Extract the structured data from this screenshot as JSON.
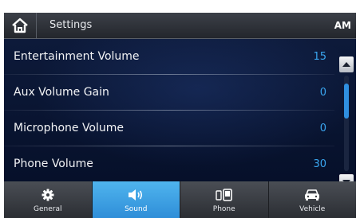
{
  "header": {
    "title": "Settings",
    "source": "AM"
  },
  "settings": [
    {
      "label": "Entertainment Volume",
      "value": "15"
    },
    {
      "label": "Aux Volume Gain",
      "value": "0"
    },
    {
      "label": "Microphone Volume",
      "value": "0"
    },
    {
      "label": "Phone Volume",
      "value": "30"
    }
  ],
  "nav": [
    {
      "label": "General",
      "icon": "gear-icon",
      "active": false
    },
    {
      "label": "Sound",
      "icon": "speaker-icon",
      "active": true
    },
    {
      "label": "Phone",
      "icon": "phone-icon",
      "active": false
    },
    {
      "label": "Vehicle",
      "icon": "car-icon",
      "active": false
    }
  ],
  "colors": {
    "accent": "#2f8ed8",
    "value_text": "#3aa6f0",
    "background": "#0a1224"
  }
}
